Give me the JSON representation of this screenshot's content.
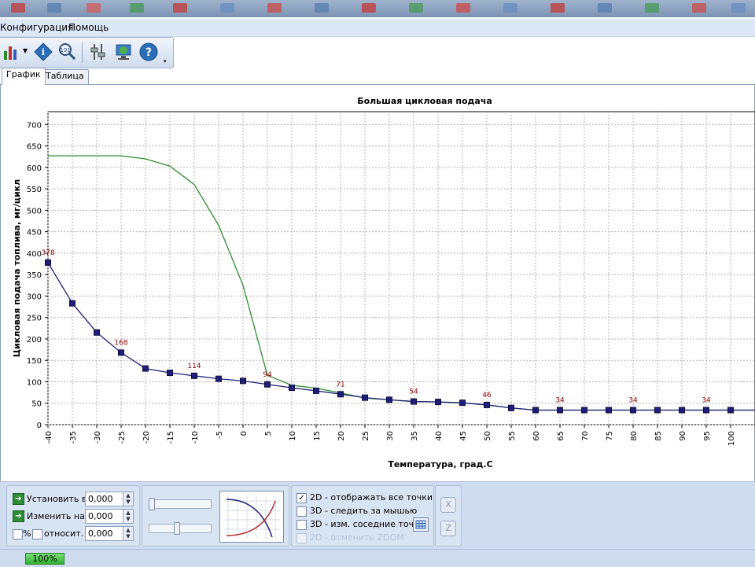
{
  "menu": {
    "items": [
      "Конфигурация",
      "Помощь"
    ]
  },
  "tabs": [
    {
      "label": "График",
      "active": true
    },
    {
      "label": "Таблица",
      "active": false
    }
  ],
  "chart_data": {
    "type": "line",
    "title": "Большая цикловая подача",
    "xlabel": "Температура, град.С",
    "ylabel": "Цикловая подача топлива, мг/цикл",
    "x": [
      -40,
      -35,
      -30,
      -25,
      -20,
      -15,
      -10,
      -5,
      0,
      5,
      10,
      15,
      20,
      25,
      30,
      35,
      40,
      45,
      50,
      55,
      60,
      65,
      70,
      75,
      80,
      85,
      90,
      95,
      100,
      105
    ],
    "xticks": [
      -40,
      -35,
      -30,
      -25,
      -20,
      -15,
      -10,
      -5,
      0,
      5,
      10,
      15,
      20,
      25,
      30,
      35,
      40,
      45,
      50,
      55,
      60,
      65,
      70,
      75,
      80,
      85,
      90,
      95,
      100
    ],
    "yticks": [
      0,
      50,
      100,
      150,
      200,
      250,
      300,
      350,
      400,
      450,
      500,
      550,
      600,
      650,
      700
    ],
    "xlim": [
      -40,
      105
    ],
    "ylim": [
      0,
      730
    ],
    "grid": true,
    "series": [
      {
        "color": "#1f1f7a",
        "markers": true,
        "values": [
          378,
          283,
          215,
          168,
          131,
          121,
          114,
          107,
          102,
          94,
          86,
          79,
          71,
          63,
          58,
          54,
          53,
          51,
          46,
          39,
          34,
          34,
          34,
          34,
          34,
          34,
          34,
          34,
          34,
          34
        ]
      },
      {
        "color": "#2e8b2e",
        "markers": false,
        "values": [
          627,
          627,
          627,
          627,
          620,
          603,
          560,
          465,
          325,
          115,
          92,
          85,
          74,
          62,
          58,
          54,
          53,
          51,
          46,
          39,
          34,
          34,
          34,
          34,
          34,
          34,
          34,
          34,
          34,
          34
        ]
      }
    ],
    "point_labels": [
      {
        "x": -40,
        "y": 378,
        "text": "378"
      },
      {
        "x": -25,
        "y": 168,
        "text": "168"
      },
      {
        "x": -10,
        "y": 114,
        "text": "114"
      },
      {
        "x": 5,
        "y": 94,
        "text": "94"
      },
      {
        "x": 20,
        "y": 71,
        "text": "71"
      },
      {
        "x": 35,
        "y": 54,
        "text": "54"
      },
      {
        "x": 50,
        "y": 46,
        "text": "46"
      },
      {
        "x": 65,
        "y": 34,
        "text": "34"
      },
      {
        "x": 80,
        "y": 34,
        "text": "34"
      },
      {
        "x": 95,
        "y": 34,
        "text": "34"
      }
    ]
  },
  "controls": {
    "set_label": "Установить в",
    "set_value": "0,000",
    "change_label": "Изменить на",
    "change_value": "0,000",
    "percent_label": "%",
    "relative_label": "относит.",
    "relative_value": "0,000"
  },
  "options": [
    {
      "label": "2D - отображать все точки",
      "checked": true,
      "enabled": true
    },
    {
      "label": "3D - следить за мышью",
      "checked": false,
      "enabled": true
    },
    {
      "label": "3D - изм. соседние точки",
      "checked": false,
      "enabled": true
    },
    {
      "label": "2D - отменить ZOOM",
      "checked": false,
      "enabled": false
    }
  ],
  "axis_buttons": {
    "x": "X",
    "z": "Z"
  },
  "status": {
    "progress_text": "100%",
    "progress": 1.0
  }
}
